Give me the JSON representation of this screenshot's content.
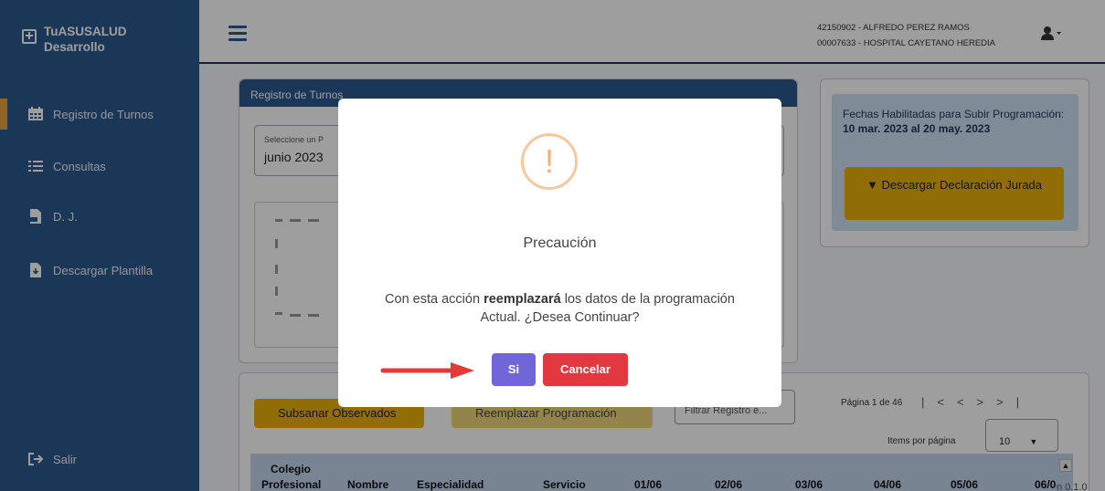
{
  "brand": {
    "line1": "TuASUSALUD",
    "line2": "Desarrollo"
  },
  "sidebar": {
    "items": [
      {
        "label": "Registro de Turnos",
        "icon": "calendar-icon"
      },
      {
        "label": "Consultas",
        "icon": "list-icon"
      },
      {
        "label": "D. J.",
        "icon": "pdf-icon"
      },
      {
        "label": "Descargar Plantilla",
        "icon": "download-file-icon"
      }
    ],
    "logout": "Salir"
  },
  "header": {
    "user_line1": "42150902 - ALFREDO PEREZ RAMOS",
    "user_line2": "00007633 - HOSPITAL CAYETANO HEREDIA"
  },
  "registro": {
    "title": "Registro de Turnos",
    "period_label": "Seleccione un P",
    "period_value": "junio 2023"
  },
  "info": {
    "dates_prefix": "Fechas Habilitadas para Subir Programación: ",
    "dates_bold": "10 mar. 2023 al 20 may. 2023",
    "download_decl": "Descargar Declaración Jurada"
  },
  "table": {
    "subsanar": "Subsanar Observados",
    "reemplazar": "Reemplazar Programación",
    "filter_placeholder": "Filtrar Registro e...",
    "page_text": "Página 1 de 46",
    "items_label": "Items por página",
    "items_value": "10",
    "headers": [
      "Colegio",
      "Profesional",
      "Nombre",
      "Especialidad",
      "Servicio",
      "01/06",
      "02/06",
      "03/06",
      "04/06",
      "05/06",
      "06/0"
    ],
    "version": "n 0.1.0"
  },
  "modal": {
    "icon": "!",
    "title": "Precaución",
    "text_prefix": "Con esta acción ",
    "text_bold": "reemplazará",
    "text_suffix": " los datos de la programación Actual. ¿Desea Continuar?",
    "confirm": "Si",
    "cancel": "Cancelar"
  },
  "colors": {
    "sidebar": "#2d5a8e",
    "accent": "#e9a23b",
    "confirm": "#7066d8",
    "cancel": "#e2383f",
    "arrow": "#e53935"
  }
}
